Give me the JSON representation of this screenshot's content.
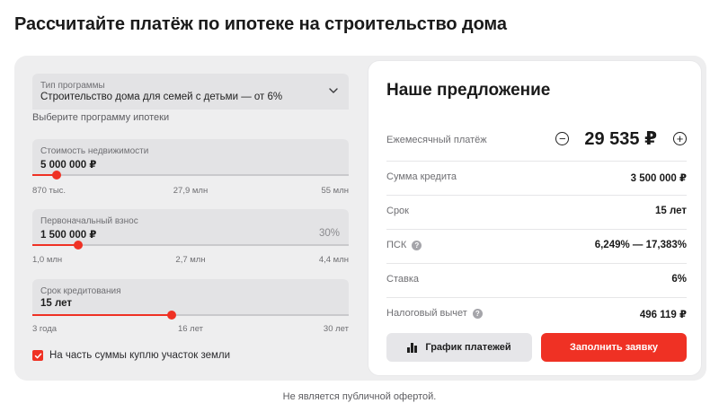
{
  "page": {
    "title": "Рассчитайте платёж по ипотеке на строительство дома"
  },
  "program": {
    "label": "Тип программы",
    "value": "Строительство дома для семей с детьми — от 6%",
    "hint": "Выберите программу ипотеки",
    "icon": "chevron-down-icon"
  },
  "property_cost": {
    "label": "Стоимость недвижимости",
    "value": "5 000 000 ₽",
    "slider_fraction": 0.077,
    "ticks": [
      "870 тыс.",
      "27,9 млн",
      "55 млн"
    ]
  },
  "down_payment": {
    "label": "Первоначальный взнос",
    "value": "1 500 000 ₽",
    "percent": "30%",
    "slider_fraction": 0.145,
    "ticks": [
      "1,0 млн",
      "2,7 млн",
      "4,4 млн"
    ]
  },
  "term": {
    "label": "Срок кредитования",
    "value": "15 лет",
    "slider_fraction": 0.44,
    "ticks": [
      "3 года",
      "16 лет",
      "30 лет"
    ]
  },
  "land_checkbox": {
    "label": "На часть суммы куплю участок земли",
    "checked": true
  },
  "offer": {
    "title": "Наше предложение",
    "monthly_label": "Ежемесячный платёж",
    "monthly_value": "29 535 ₽",
    "minus": "−",
    "plus": "+",
    "rows": [
      {
        "label": "Сумма кредита",
        "value": "3 500 000 ₽"
      },
      {
        "label": "Срок",
        "value": "15 лет"
      },
      {
        "label": "ПСК",
        "value": "6,249% — 17,383%",
        "info": "?"
      },
      {
        "label": "Ставка",
        "value": "6%"
      },
      {
        "label": "Налоговый вычет",
        "value": "496 119 ₽",
        "info": "?"
      }
    ],
    "schedule_button": "График платежей",
    "apply_button": "Заполнить заявку"
  },
  "disclaimer": "Не является публичной офертой.",
  "colors": {
    "accent": "#ef3124",
    "panel": "#eeeeef",
    "field": "#e3e3e5"
  }
}
